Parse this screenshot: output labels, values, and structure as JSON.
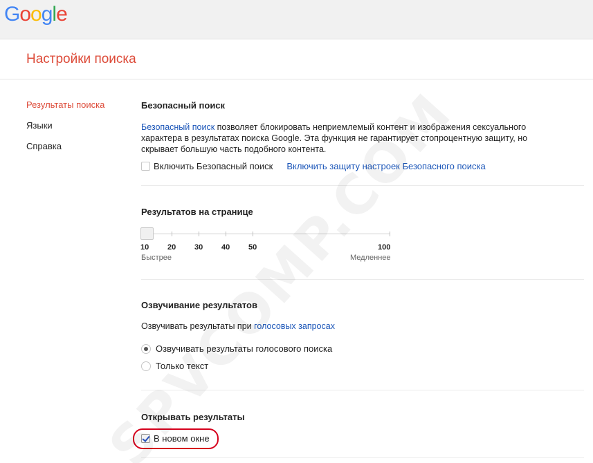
{
  "logo": {
    "letters": [
      "G",
      "o",
      "o",
      "g",
      "l",
      "e"
    ],
    "colors": [
      "#4285f4",
      "#ea4335",
      "#fbbc05",
      "#4285f4",
      "#34a853",
      "#ea4335"
    ]
  },
  "page_title": "Настройки поиска",
  "sidebar": {
    "items": [
      {
        "label": "Результаты поиска",
        "active": true
      },
      {
        "label": "Языки",
        "active": false
      },
      {
        "label": "Справка",
        "active": false
      }
    ]
  },
  "safe_search": {
    "title": "Безопасный поиск",
    "link_text": "Безопасный поиск",
    "description": " позволяет блокировать неприемлемый контент и изображения сексуального характера в результатах поиска Google. Эта функция не гарантирует стопроцентную защиту, но скрывает большую часть подобного контента.",
    "checkbox_label": "Включить Безопасный поиск",
    "checkbox_checked": false,
    "lock_link": "Включить защиту настроек Безопасного поиска"
  },
  "results_per_page": {
    "title": "Результатов на странице",
    "ticks": [
      "10",
      "20",
      "30",
      "40",
      "50",
      "100"
    ],
    "selected": "10",
    "faster_label": "Быстрее",
    "slower_label": "Медленнее"
  },
  "spoken_results": {
    "title": "Озвучивание результатов",
    "desc_prefix": "Озвучивать результаты при ",
    "desc_link": "голосовых запросах",
    "options": [
      {
        "label": "Озвучивать результаты голосового поиска",
        "checked": true
      },
      {
        "label": "Только текст",
        "checked": false
      }
    ]
  },
  "open_results": {
    "title": "Открывать результаты",
    "checkbox_label": "В новом окне",
    "checkbox_checked": true
  },
  "watermark": "SPVCOMP.COM",
  "colors": {
    "accent_red": "#dd4b39",
    "link_blue": "#1a55b8",
    "highlight_red": "#d6001c"
  }
}
